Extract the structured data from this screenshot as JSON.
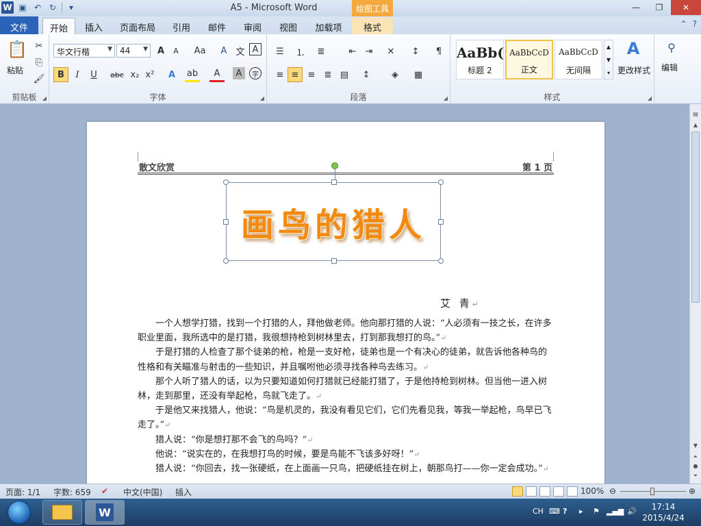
{
  "window": {
    "title": "A5 - Microsoft Word",
    "context_tab_group": "绘图工具"
  },
  "tabs": [
    "文件",
    "开始",
    "插入",
    "页面布局",
    "引用",
    "邮件",
    "审阅",
    "视图",
    "加载项",
    "格式"
  ],
  "ribbon": {
    "clipboard": {
      "paste": "粘贴",
      "label": "剪贴板"
    },
    "font": {
      "name": "华文行楷",
      "size": "44",
      "label": "字体",
      "bold": "B",
      "italic": "I",
      "underline": "U",
      "strike": "abc",
      "sub": "x₂",
      "sup": "x²",
      "grow": "A",
      "shrink": "A",
      "case": "Aa",
      "clear": "A",
      "color_a": "A",
      "highlight": "ab",
      "shade": "A",
      "enclose": "字"
    },
    "paragraph": {
      "label": "段落"
    },
    "styles": {
      "label": "样式",
      "items": [
        {
          "sample": "AaBb(",
          "name": "标题 2"
        },
        {
          "sample": "AaBbCcD",
          "name": "正文"
        },
        {
          "sample": "AaBbCcD",
          "name": "无间隔"
        }
      ],
      "change": "更改样式"
    },
    "editing": {
      "label": "编辑"
    }
  },
  "document": {
    "header_left": "散文欣赏",
    "header_right": "第 1 页",
    "wordart": "画鸟的猎人",
    "author": "艾 青",
    "paragraphs": [
      "一个人想学打猎，找到一个打猎的人，拜他做老师。他向那打猎的人说：“人必须有一技之长，在许多职业里面，我所选中的是打猎，我很想持枪到树林里去，打到那我想打的鸟。”",
      "于是打猎的人检查了那个徒弟的枪，枪是一支好枪，徒弟也是一个有决心的徒弟，就告诉他各种鸟的性格和有关瞄准与射击的一些知识，并且嘱咐他必须寻找各种鸟去练习。",
      "那个人听了猎人的话，以为只要知道如何打猎就已经能打猎了，于是他持枪到树林。但当他一进入树林，走到那里，还没有举起枪，鸟就飞走了。",
      "于是他又来找猎人，他说：“鸟是机灵的，我没有看见它们，它们先看见我，等我一举起枪，鸟早已飞走了。”",
      "猎人说：“你是想打那不会飞的鸟吗？”",
      "他说：“说实在的，在我想打鸟的时候，要是鸟能不飞该多好呀！”",
      "猎人说：“你回去，找一张硬纸，在上面画一只鸟，把硬纸挂在树上，朝那鸟打——你一定会成功。”"
    ]
  },
  "statusbar": {
    "page": "页面: 1/1",
    "words": "字数: 659",
    "lang": "中文(中国)",
    "mode": "插入",
    "zoom": "100%"
  },
  "taskbar": {
    "ime": "CH",
    "time": "17:14",
    "date": "2015/4/24"
  },
  "colors": {
    "file_tab": "#2b63b8",
    "context_tab": "#f4a93e",
    "wordart": "#f28a12",
    "close_button": "#c9463d"
  }
}
